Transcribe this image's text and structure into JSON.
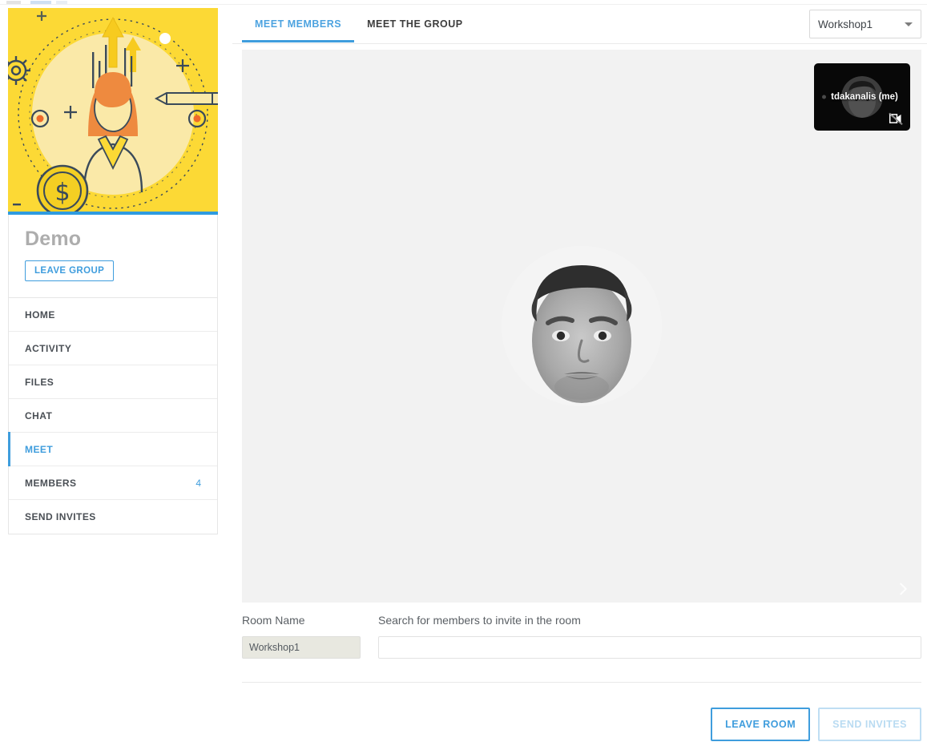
{
  "group": {
    "name": "Demo",
    "leave_group_label": "LEAVE GROUP",
    "image_alt": "group-illustration"
  },
  "sidebar": {
    "items": [
      {
        "label": "HOME",
        "badge": "",
        "active": false
      },
      {
        "label": "ACTIVITY",
        "badge": "",
        "active": false
      },
      {
        "label": "FILES",
        "badge": "",
        "active": false
      },
      {
        "label": "CHAT",
        "badge": "",
        "active": false
      },
      {
        "label": "MEET",
        "badge": "",
        "active": true
      },
      {
        "label": "MEMBERS",
        "badge": "4",
        "active": false
      },
      {
        "label": "SEND INVITES",
        "badge": "",
        "active": false
      }
    ]
  },
  "main": {
    "tabs": [
      {
        "label": "MEET MEMBERS",
        "active": true
      },
      {
        "label": "MEET THE GROUP",
        "active": false
      }
    ],
    "room_select": {
      "value": "Workshop1",
      "caret_icon": "chevron-down-icon"
    },
    "stage": {
      "self_tile": {
        "name": "tdakanalis (me)",
        "video_off_icon": "videocam-off-icon",
        "mic_icon": "mic-dot-icon"
      },
      "next_icon": "chevron-right-icon"
    },
    "form": {
      "room_name_label": "Room Name",
      "room_name_value": "Workshop1",
      "search_label": "Search for members to invite in the room",
      "search_value": "",
      "search_placeholder": ""
    },
    "actions": {
      "leave_room_label": "LEAVE ROOM",
      "send_invites_label": "SEND INVITES"
    }
  },
  "colors": {
    "accent": "#3f9ddd",
    "accent_light": "#4da3e0",
    "disabled_blue": "#b9dbf2",
    "stage_bg": "#f2f2f2",
    "illustration_yellow": "#fcd935"
  }
}
